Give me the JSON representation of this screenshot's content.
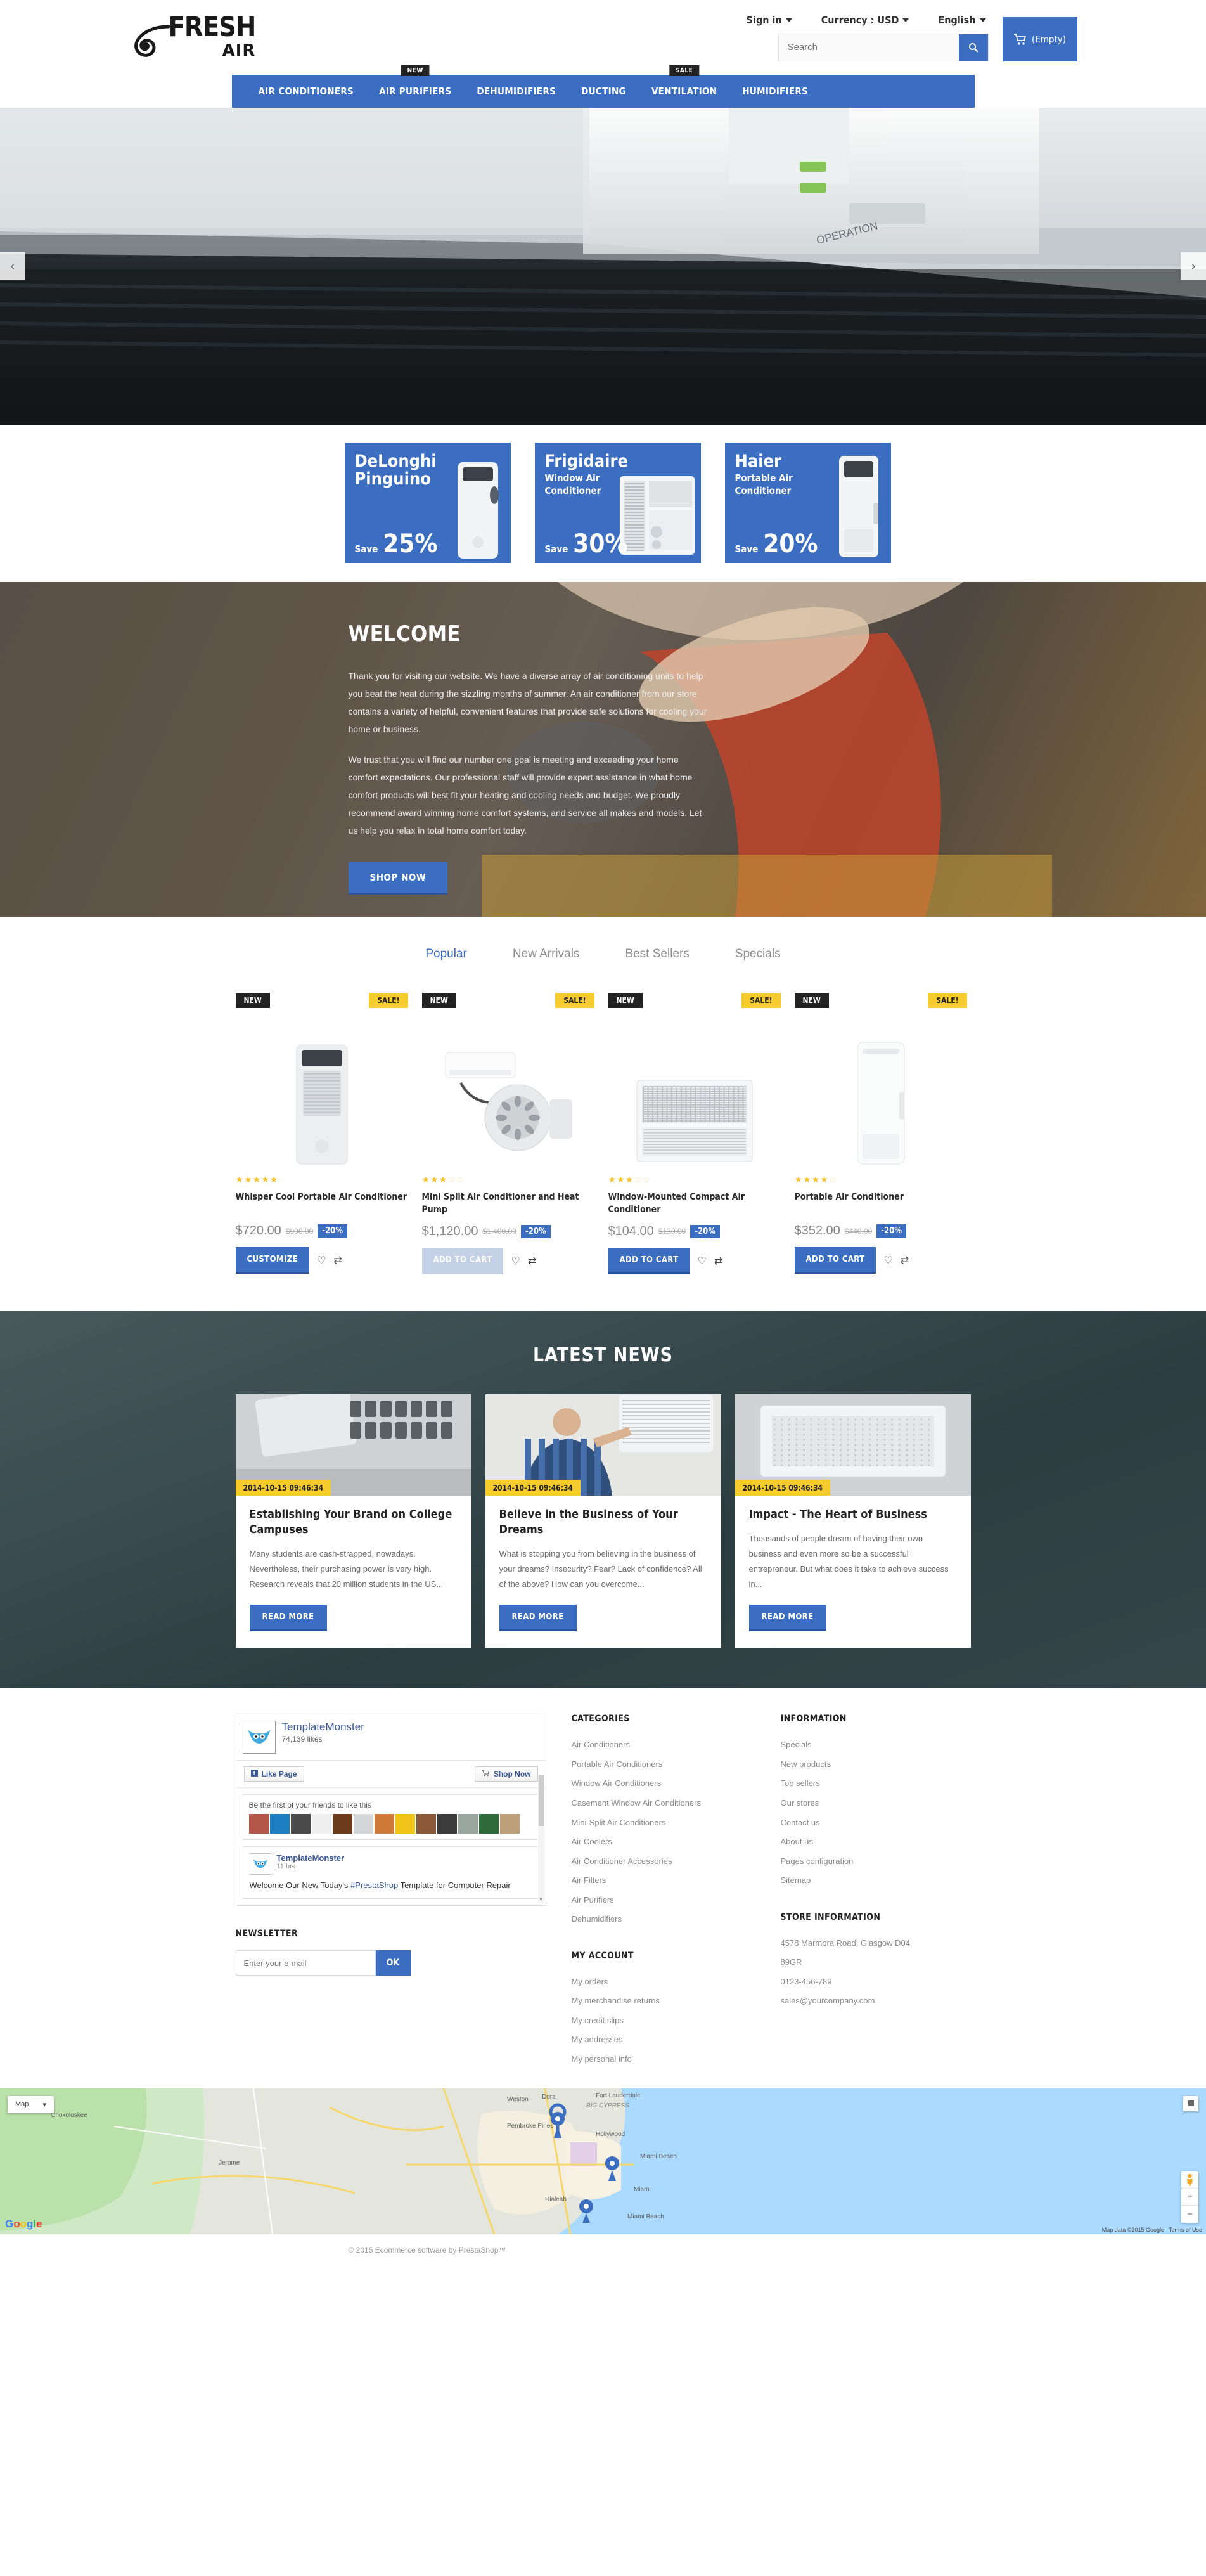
{
  "header": {
    "logo_primary": "FRESH",
    "logo_secondary": "AIR",
    "sign_in": "Sign in",
    "currency": "Currency : USD",
    "language": "English",
    "search_placeholder": "Search",
    "search_value": "",
    "cart_label": "(Empty)",
    "accent": "#3b6ec1"
  },
  "nav": {
    "items": [
      {
        "label": "AIR CONDITIONERS",
        "badge": ""
      },
      {
        "label": "AIR PURIFIERS",
        "badge": "NEW"
      },
      {
        "label": "DEHUMIDIFIERS",
        "badge": ""
      },
      {
        "label": "DUCTING",
        "badge": ""
      },
      {
        "label": "VENTILATION",
        "badge": "SALE"
      },
      {
        "label": "HUMIDIFIERS",
        "badge": ""
      }
    ]
  },
  "hero": {
    "prev": "‹",
    "next": "›",
    "caption": "OPERATION"
  },
  "promos": [
    {
      "brand": "DeLonghi Pinguino",
      "sub": "",
      "save_label": "Save",
      "percent": "25%"
    },
    {
      "brand": "Frigidaire",
      "sub": "Window Air Conditioner",
      "save_label": "Save",
      "percent": "30%"
    },
    {
      "brand": "Haier",
      "sub": "Portable Air Conditioner",
      "save_label": "Save",
      "percent": "20%"
    }
  ],
  "welcome": {
    "title": "WELCOME",
    "paragraph1": "Thank you for visiting our website. We have a diverse array of air conditioning units to help you beat the heat during the sizzling months of summer. An air conditioner from our store contains a variety of helpful, convenient features that provide safe solutions for cooling your home or business.",
    "paragraph2": "We trust that you will find our number one goal is meeting and exceeding your home comfort expectations. Our professional staff will provide expert assistance in what home comfort products will best fit your heating and cooling needs and budget. We proudly recommend award winning home comfort systems, and service all makes and models. Let us help you relax in total home comfort today.",
    "button": "SHOP NOW"
  },
  "products": {
    "tabs": [
      {
        "label": "Popular",
        "active": true
      },
      {
        "label": "New Arrivals",
        "active": false
      },
      {
        "label": "Best Sellers",
        "active": false
      },
      {
        "label": "Specials",
        "active": false
      }
    ],
    "items": [
      {
        "badge_new": "NEW",
        "badge_sale": "SALE!",
        "rating": 5,
        "name": "Whisper Cool Portable Air Conditioner",
        "price": "$720.00",
        "old_price": "$900.00",
        "discount": "-20%",
        "cta": "CUSTOMIZE",
        "cta_disabled": false
      },
      {
        "badge_new": "NEW",
        "badge_sale": "SALE!",
        "rating": 3,
        "name": "Mini Split Air Conditioner and Heat Pump",
        "price": "$1,120.00",
        "old_price": "$1,400.00",
        "discount": "-20%",
        "cta": "ADD TO CART",
        "cta_disabled": true
      },
      {
        "badge_new": "NEW",
        "badge_sale": "SALE!",
        "rating": 3,
        "name": "Window-Mounted Compact Air Conditioner",
        "price": "$104.00",
        "old_price": "$130.00",
        "discount": "-20%",
        "cta": "ADD TO CART",
        "cta_disabled": false
      },
      {
        "badge_new": "NEW",
        "badge_sale": "SALE!",
        "rating": 4,
        "name": "Portable Air Conditioner",
        "price": "$352.00",
        "old_price": "$440.00",
        "discount": "-20%",
        "cta": "ADD TO CART",
        "cta_disabled": false
      }
    ]
  },
  "news": {
    "title": "LATEST NEWS",
    "read_more": "READ MORE",
    "items": [
      {
        "date": "2014-10-15 09:46:34",
        "title": "Establishing Your Brand on College Campuses",
        "excerpt": "Many students are cash-strapped, nowadays. Nevertheless, their purchasing power is very high. Research reveals that 20 million students in the US..."
      },
      {
        "date": "2014-10-15 09:46:34",
        "title": "Believe in the Business of Your Dreams",
        "excerpt": "What is stopping you from believing in the business of your dreams? Insecurity? Fear? Lack of confidence? All of the above? How can you overcome..."
      },
      {
        "date": "2014-10-15 09:46:34",
        "title": "Impact - The Heart of Business",
        "excerpt": "Thousands of people dream of having their own business and even more so be a successful entrepreneur. But what does it take to achieve success in..."
      }
    ]
  },
  "facebook": {
    "page_name": "TemplateMonster",
    "likes": "74,139 likes",
    "like_button": "Like Page",
    "shop_button": "Shop Now",
    "friends_hint": "Be the first of your friends to like this",
    "post_author": "TemplateMonster",
    "post_time": "11 hrs",
    "post_text_before": "Welcome Our New Today's ",
    "post_hashtag": "#PrestaShop",
    "post_text_after": " Template for Computer Repair"
  },
  "newsletter": {
    "title": "NEWSLETTER",
    "placeholder": "Enter your e-mail",
    "value": "",
    "ok": "OK"
  },
  "footer": {
    "categories_title": "CATEGORIES",
    "categories": [
      "Air Conditioners",
      "Portable Air Conditioners",
      "Window Air Conditioners",
      "Casement Window Air Conditioners",
      "Mini-Split Air Conditioners",
      "Air Coolers",
      "Air Conditioner Accessories",
      "Air Filters",
      "Air Purifiers",
      "Dehumidifiers"
    ],
    "my_account_title": "MY ACCOUNT",
    "my_account": [
      "My orders",
      "My merchandise returns",
      "My credit slips",
      "My addresses",
      "My personal info"
    ],
    "information_title": "INFORMATION",
    "information": [
      "Specials",
      "New products",
      "Top sellers",
      "Our stores",
      "Contact us",
      "About us",
      "Pages configuration",
      "Sitemap"
    ],
    "store_title": "STORE INFORMATION",
    "store_lines": [
      "4578 Marmora Road, Glasgow D04",
      "89GR",
      "0123-456-789",
      "sales@yourcompany.com"
    ]
  },
  "map": {
    "type_label": "Map",
    "zoom_in": "+",
    "zoom_out": "−",
    "attribution": "Map data ©2015 Google",
    "terms": "Terms of Use",
    "logo": "Google",
    "labels": [
      "Chokoloskee",
      "Jerome",
      "BIG CYPRESS",
      "Weston",
      "Fort Lauderdale",
      "Hollywood",
      "Pembroke Pines",
      "Dora",
      "Miami Beach",
      "Hialeah",
      "Miami",
      "Miami Beach"
    ]
  },
  "copyright": {
    "text": "© 2015 Ecommerce software by PrestaShop™"
  }
}
